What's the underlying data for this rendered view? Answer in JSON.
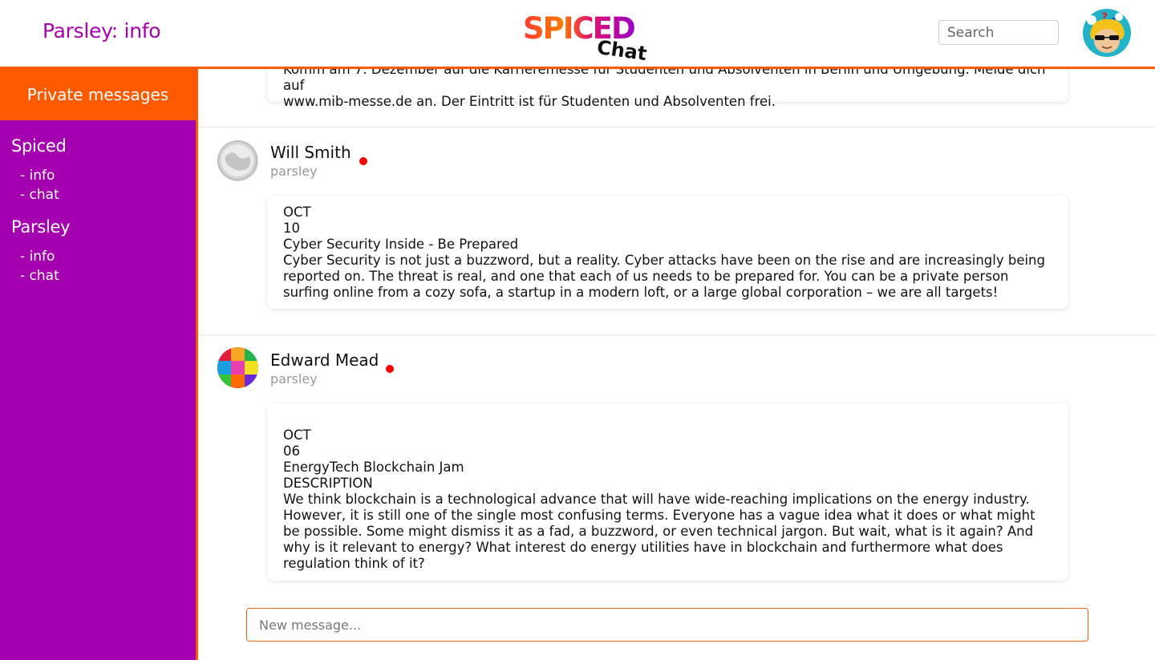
{
  "header": {
    "page_title": "Parsley: info",
    "logo_text_top": "SPICED",
    "logo_text_bottom": "Chat",
    "search_placeholder": "Search",
    "user_avatar_icon": "cartoon-avatar-icon"
  },
  "colors": {
    "accent_orange": "#ff5a00",
    "sidebar_purple": "#a400b0",
    "title_purple": "#a800b0",
    "online_red": "#ff0000"
  },
  "sidebar": {
    "header": "Private messages",
    "groups": [
      {
        "title": "Spiced",
        "links": [
          "- info",
          "- chat"
        ]
      },
      {
        "title": "Parsley",
        "links": [
          "- info",
          "- chat"
        ]
      }
    ]
  },
  "messages": [
    {
      "author": "",
      "channel": "",
      "lines": [
        "Komm am 7. Dezember auf die Karrieremesse für Studenten und Absolventen in Berlin und Umgebung. Melde dich auf",
        "www.mib-messe.de an. Der Eintritt ist für Studenten und Absolventen frei."
      ]
    },
    {
      "author": "Will Smith",
      "channel": "parsley",
      "online": true,
      "lines": [
        "OCT",
        "10",
        "Cyber Security Inside - Be Prepared",
        "Cyber Security is not just a buzzword, but a reality. Cyber attacks have been on the rise and are increasingly being reported on. The threat is real, and one that each of us needs to be prepared for. You can be a private person surfing online from a cozy sofa, a startup in a modern loft, or a large global corporation – we are all targets!"
      ]
    },
    {
      "author": "Edward Mead",
      "channel": "parsley",
      "online": true,
      "lines": [
        "OCT",
        "06",
        "EnergyTech Blockchain Jam",
        "DESCRIPTION",
        "We think blockchain is a technological advance that will have wide-reaching implications on the energy industry. However, it is still one of the single most confusing terms. Everyone has a vague idea what it does or what might be possible. Some might dismiss it as a fad, a buzzword, or even technical jargon. But wait, what is it again? And why is it relevant to energy? What interest do energy utilities have in blockchain and furthermore what does regulation think of it?"
      ]
    }
  ],
  "composer": {
    "placeholder": "New message..."
  }
}
